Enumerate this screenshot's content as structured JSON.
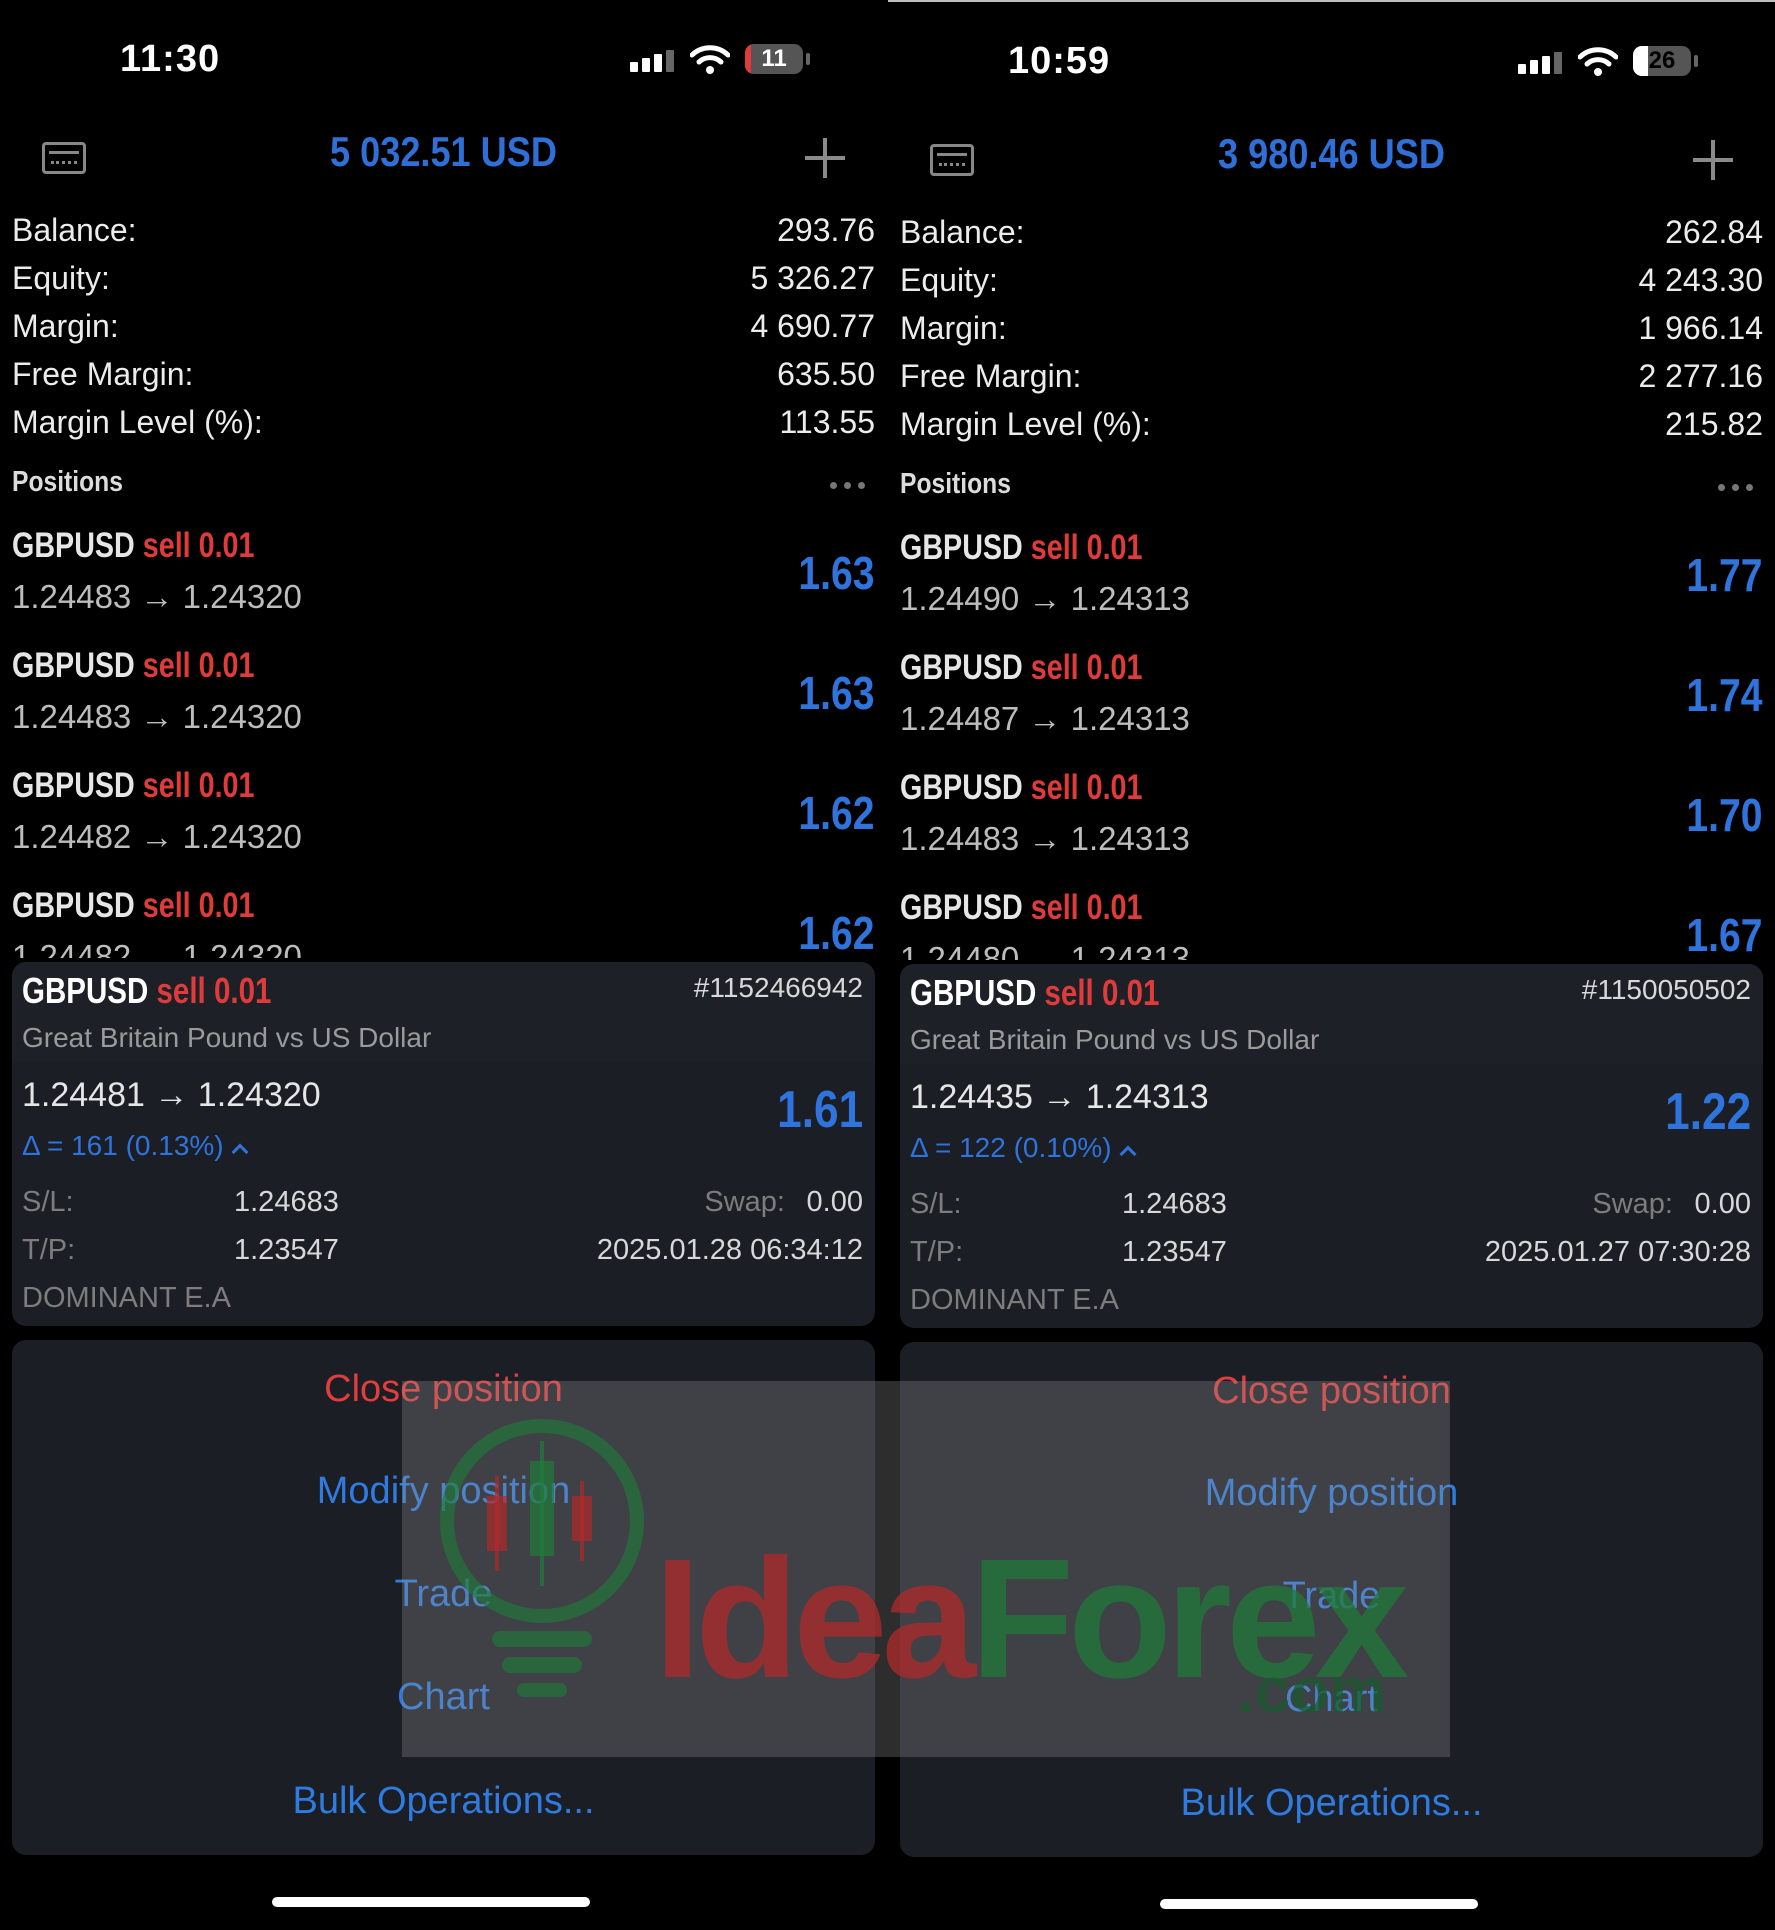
{
  "watermark": {
    "brand_a": "Idea",
    "brand_b": "Forex",
    "brand_suffix": ".com"
  },
  "phones": [
    {
      "status": {
        "time": "11:30",
        "battery": "11",
        "battery_level": 0.11,
        "battery_color": "#e23b3b"
      },
      "header": {
        "total": "5 032.51 USD"
      },
      "summary": [
        {
          "label": "Balance:",
          "value": "293.76"
        },
        {
          "label": "Equity:",
          "value": "5 326.27"
        },
        {
          "label": "Margin:",
          "value": "4 690.77"
        },
        {
          "label": "Free Margin:",
          "value": "635.50"
        },
        {
          "label": "Margin Level (%):",
          "value": "113.55"
        }
      ],
      "positions_title": "Positions",
      "positions": [
        {
          "symbol": "GBPUSD",
          "side": "sell 0.01",
          "prices": "1.24483 → 1.24320",
          "profit": "1.63"
        },
        {
          "symbol": "GBPUSD",
          "side": "sell 0.01",
          "prices": "1.24483 → 1.24320",
          "profit": "1.63"
        },
        {
          "symbol": "GBPUSD",
          "side": "sell 0.01",
          "prices": "1.24482 → 1.24320",
          "profit": "1.62"
        },
        {
          "symbol": "GBPUSD",
          "side": "sell 0.01",
          "prices": "1.24482 → 1.24320",
          "profit": "1.62"
        }
      ],
      "detail": {
        "symbol": "GBPUSD",
        "side": "sell 0.01",
        "ticket": "#1152466942",
        "description": "Great Britain Pound vs US Dollar",
        "prices": "1.24481 → 1.24320",
        "profit": "1.61",
        "delta": "Δ = 161 (0.13%)",
        "sl_label": "S/L:",
        "sl": "1.24683",
        "tp_label": "T/P:",
        "tp": "1.23547",
        "swap_label": "Swap:",
        "swap": "0.00",
        "datetime": "2025.01.28 06:34:12",
        "comment": "DOMINANT E.A"
      },
      "actions": {
        "close": "Close position",
        "modify": "Modify position",
        "trade": "Trade",
        "chart": "Chart",
        "bulk": "Bulk Operations..."
      }
    },
    {
      "status": {
        "time": "10:59",
        "battery": "26",
        "battery_level": 0.26,
        "battery_color": "#ffffff"
      },
      "header": {
        "total": "3 980.46 USD"
      },
      "summary": [
        {
          "label": "Balance:",
          "value": "262.84"
        },
        {
          "label": "Equity:",
          "value": "4 243.30"
        },
        {
          "label": "Margin:",
          "value": "1 966.14"
        },
        {
          "label": "Free Margin:",
          "value": "2 277.16"
        },
        {
          "label": "Margin Level (%):",
          "value": "215.82"
        }
      ],
      "positions_title": "Positions",
      "positions": [
        {
          "symbol": "GBPUSD",
          "side": "sell 0.01",
          "prices": "1.24490 → 1.24313",
          "profit": "1.77"
        },
        {
          "symbol": "GBPUSD",
          "side": "sell 0.01",
          "prices": "1.24487 → 1.24313",
          "profit": "1.74"
        },
        {
          "symbol": "GBPUSD",
          "side": "sell 0.01",
          "prices": "1.24483 → 1.24313",
          "profit": "1.70"
        },
        {
          "symbol": "GBPUSD",
          "side": "sell 0.01",
          "prices": "1.24480 → 1.24313",
          "profit": "1.67"
        }
      ],
      "detail": {
        "symbol": "GBPUSD",
        "side": "sell 0.01",
        "ticket": "#1150050502",
        "description": "Great Britain Pound vs US Dollar",
        "prices": "1.24435 → 1.24313",
        "profit": "1.22",
        "delta": "Δ = 122 (0.10%)",
        "sl_label": "S/L:",
        "sl": "1.24683",
        "tp_label": "T/P:",
        "tp": "1.23547",
        "swap_label": "Swap:",
        "swap": "0.00",
        "datetime": "2025.01.27 07:30:28",
        "comment": "DOMINANT E.A"
      },
      "actions": {
        "close": "Close position",
        "modify": "Modify position",
        "trade": "Trade",
        "chart": "Chart",
        "bulk": "Bulk Operations..."
      }
    }
  ]
}
